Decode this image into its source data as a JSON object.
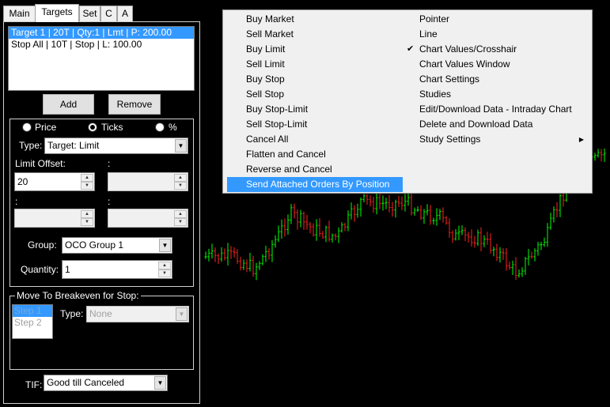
{
  "tabs": [
    {
      "label": "Main",
      "active": false
    },
    {
      "label": "Targets",
      "active": true
    },
    {
      "label": "Set",
      "active": false
    },
    {
      "label": "C",
      "active": false
    },
    {
      "label": "A",
      "active": false
    }
  ],
  "orders": [
    {
      "label": "Target 1 | 20T | Qty:1 | Lmt | P: 200.00",
      "selected": true
    },
    {
      "label": "Stop All | 10T | Stop | L: 100.00",
      "selected": false
    }
  ],
  "buttons": {
    "add": "Add",
    "remove": "Remove"
  },
  "offset_mode": {
    "options": [
      "Price",
      "Ticks",
      "%"
    ],
    "selected": "Ticks"
  },
  "type": {
    "label": "Type:",
    "value": "Target: Limit"
  },
  "limit_offset": {
    "label": "Limit Offset:",
    "value": "20"
  },
  "colon_labels": [
    ":",
    ":",
    ":"
  ],
  "group": {
    "label": "Group:",
    "value": "OCO Group 1"
  },
  "quantity": {
    "label": "Quantity:",
    "value": "1"
  },
  "breakeven": {
    "title": "Move To Breakeven for Stop:",
    "steps": [
      "Step 1",
      "Step 2"
    ],
    "type_label": "Type:",
    "type_value": "None"
  },
  "tif": {
    "label": "TIF:",
    "value": "Good till Canceled"
  },
  "icons": {
    "dropdown": "triangle-down-icon",
    "spin_up": "triangle-up-icon",
    "spin_down": "triangle-down-icon",
    "check": "check-icon",
    "submenu": "triangle-right-icon"
  },
  "colors": {
    "selection": "#3399ff",
    "up_bar": "#00ff00",
    "down_bar": "#ff2020",
    "menu_bg": "#f0f0f0"
  },
  "context_menu": {
    "left_column": [
      "Buy Market",
      "Sell Market",
      "Buy Limit",
      "Sell Limit",
      "Buy Stop",
      "Sell Stop",
      "Buy Stop-Limit",
      "Sell Stop-Limit",
      "Cancel All",
      "Flatten and Cancel",
      "Reverse and Cancel",
      "Send Attached Orders By Position"
    ],
    "highlighted": "Send Attached Orders By Position",
    "right_column": [
      {
        "label": "Pointer",
        "checked": false,
        "submenu": false
      },
      {
        "label": "Line",
        "checked": false,
        "submenu": false
      },
      {
        "label": "Chart Values/Crosshair",
        "checked": true,
        "submenu": false
      },
      {
        "label": "Chart Values Window",
        "checked": false,
        "submenu": false
      },
      {
        "label": "Chart Settings",
        "checked": false,
        "submenu": false
      },
      {
        "label": "Studies",
        "checked": false,
        "submenu": false
      },
      {
        "label": "Edit/Download Data - Intraday Chart",
        "checked": false,
        "submenu": false
      },
      {
        "label": "Delete and Download Data",
        "checked": false,
        "submenu": false
      },
      {
        "label": "Study Settings",
        "checked": false,
        "submenu": true
      }
    ]
  },
  "chart_data": {
    "type": "ohlc",
    "bars": [
      {
        "o": 352,
        "h": 348,
        "l": 360,
        "c": 355
      }
    ]
  }
}
